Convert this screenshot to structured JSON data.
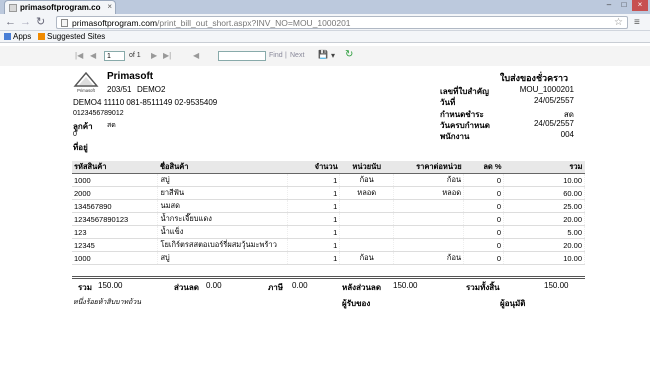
{
  "browser": {
    "tab_title": "primasoftprogram.co",
    "tab_close": "×",
    "url_host": "primasoftprogram.com",
    "url_path": "/print_bill_out_short.aspx?INV_NO=MOU_1000201",
    "win_minimize": "–",
    "win_restore": "□",
    "win_close": "×",
    "bookmarks": [
      {
        "label": "Apps",
        "color": "#4a7fd6"
      },
      {
        "label": "Suggested Sites",
        "color": "#f08a00"
      }
    ]
  },
  "viewer": {
    "first": "|◀",
    "prev": "◀",
    "page_value": "1",
    "of_label": "of 1",
    "next": "▶",
    "last": "▶|",
    "back": "◀",
    "find_label": "Find",
    "separator": "|",
    "next_label": "Next",
    "export_icon": "💾",
    "export_arrow": "▾",
    "refresh_icon": "↻"
  },
  "report": {
    "company": "Primasoft",
    "logo_text": "Primasoft",
    "doc_title": "ใบส่งของชั่วคราว",
    "branch_code": "203/51",
    "branch_name": "DEMO2",
    "customer_line": "DEMO4  11110  081-8511149  02-9535409",
    "tax_id": "0123456789012",
    "customer_label": "ลูกค้า",
    "customer_value": "สด",
    "address_code": "0",
    "address_label": "ที่อยู่",
    "info": [
      {
        "label": "เลขที่ใบสำคัญ",
        "value": "MOU_1000201"
      },
      {
        "label": "วันที่",
        "value": "24/05/2557"
      },
      {
        "label": "กำหนดชำระ",
        "value": "สด"
      },
      {
        "label": "วันครบกำหนด",
        "value": "24/05/2557"
      },
      {
        "label": "พนักงาน",
        "value": "004"
      }
    ],
    "columns": [
      "รหัสสินค้า",
      "ชื่อสินค้า",
      "จำนวน",
      "หน่วยนับ",
      "ราคาต่อหน่วย",
      "ลด %",
      "รวม"
    ],
    "rows": [
      [
        "1000",
        "สบู่",
        "1",
        "ก้อน",
        "ก้อน",
        "0",
        "10.00"
      ],
      [
        "2000",
        "ยาสีฟัน",
        "1",
        "หลอด",
        "หลอด",
        "0",
        "60.00"
      ],
      [
        "134567890",
        "นมสด",
        "1",
        "",
        "",
        "0",
        "25.00"
      ],
      [
        "1234567890123",
        "น้ำกระเจี๊ยบแดง",
        "1",
        "",
        "",
        "0",
        "20.00"
      ],
      [
        "123",
        "น้ำแข็ง",
        "1",
        "",
        "",
        "0",
        "5.00"
      ],
      [
        "12345",
        "โยเกิร์ตรสสตอเบอร์รี่ผสมวุ้นมะพร้าว",
        "1",
        "",
        "",
        "0",
        "20.00"
      ],
      [
        "1000",
        "สบู่",
        "1",
        "ก้อน",
        "ก้อน",
        "0",
        "10.00"
      ]
    ],
    "totals": {
      "total_label": "รวม",
      "total_value": "150.00",
      "discount_label": "ส่วนลด",
      "discount_value": "0.00",
      "vat_label": "ภาษี",
      "vat_value": "0.00",
      "after_discount_label": "หลังส่วนลด",
      "after_discount_value": "150.00",
      "grand_label": "รวมทั้งสิ้น",
      "grand_value": "150.00",
      "amount_words": "หนึ่งร้อยห้าสิบบาทถ้วน",
      "receiver_label": "ผู้รับของ",
      "approver_label": "ผู้อนุมัติ"
    }
  }
}
